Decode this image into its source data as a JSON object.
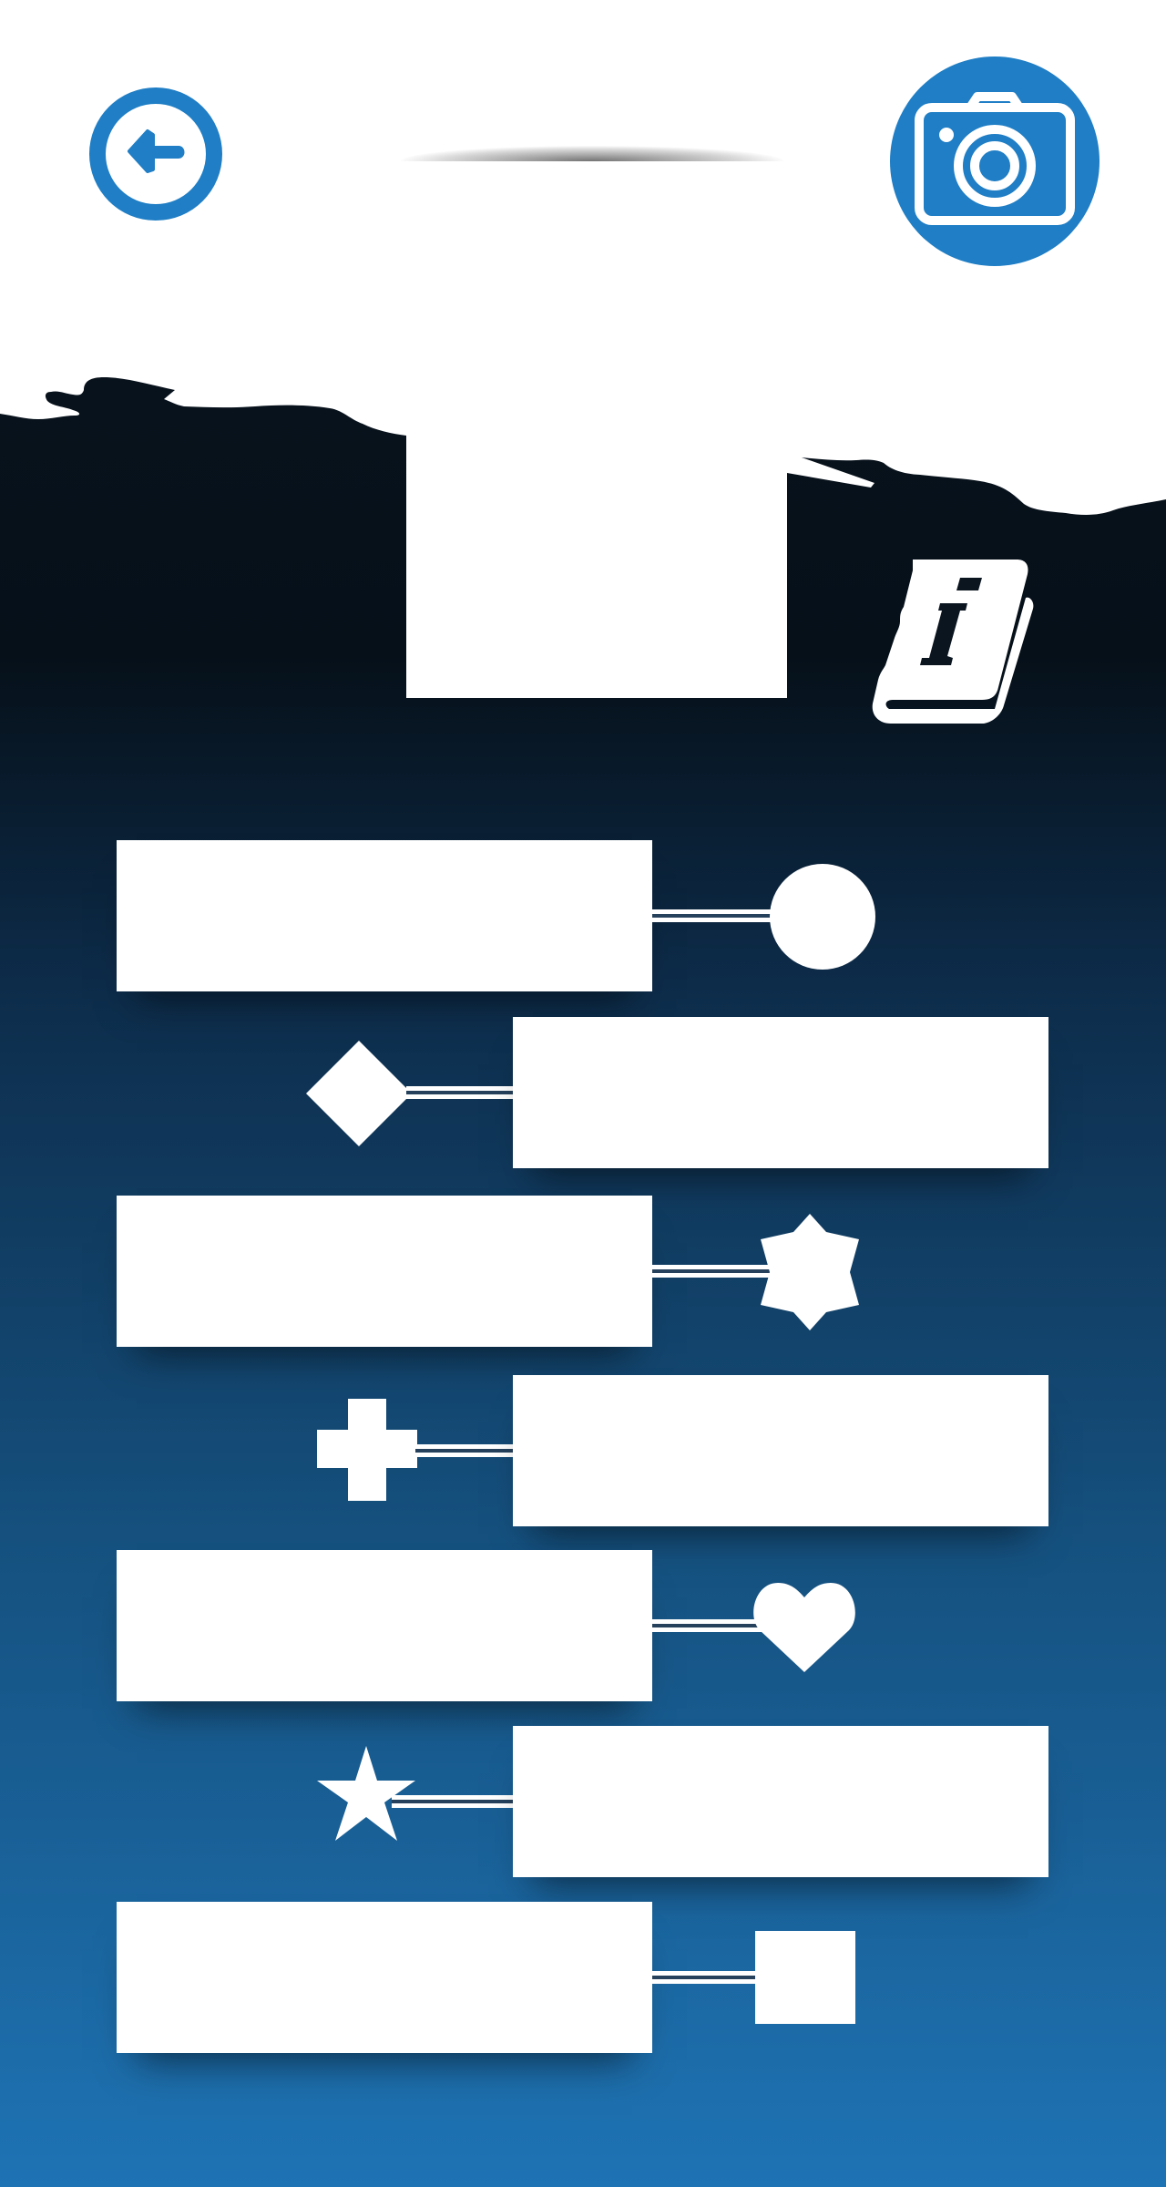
{
  "header": {
    "back_icon": "back-arrow-icon",
    "title": "",
    "camera_icon": "camera-icon"
  },
  "hero": {
    "title": "",
    "book_icon": "book-icon"
  },
  "items": [
    {
      "label": "",
      "icon": "circle-icon"
    },
    {
      "label": "",
      "icon": "diamond-icon"
    },
    {
      "label": "",
      "icon": "hexagram-icon"
    },
    {
      "label": "",
      "icon": "plus-icon"
    },
    {
      "label": "",
      "icon": "heart-icon"
    },
    {
      "label": "",
      "icon": "star-icon"
    },
    {
      "label": "",
      "icon": "square-icon"
    }
  ],
  "colors": {
    "accent": "#1f7ec5",
    "background_top": "#061019",
    "background_bottom": "#1e73b4",
    "card": "#ffffff"
  }
}
